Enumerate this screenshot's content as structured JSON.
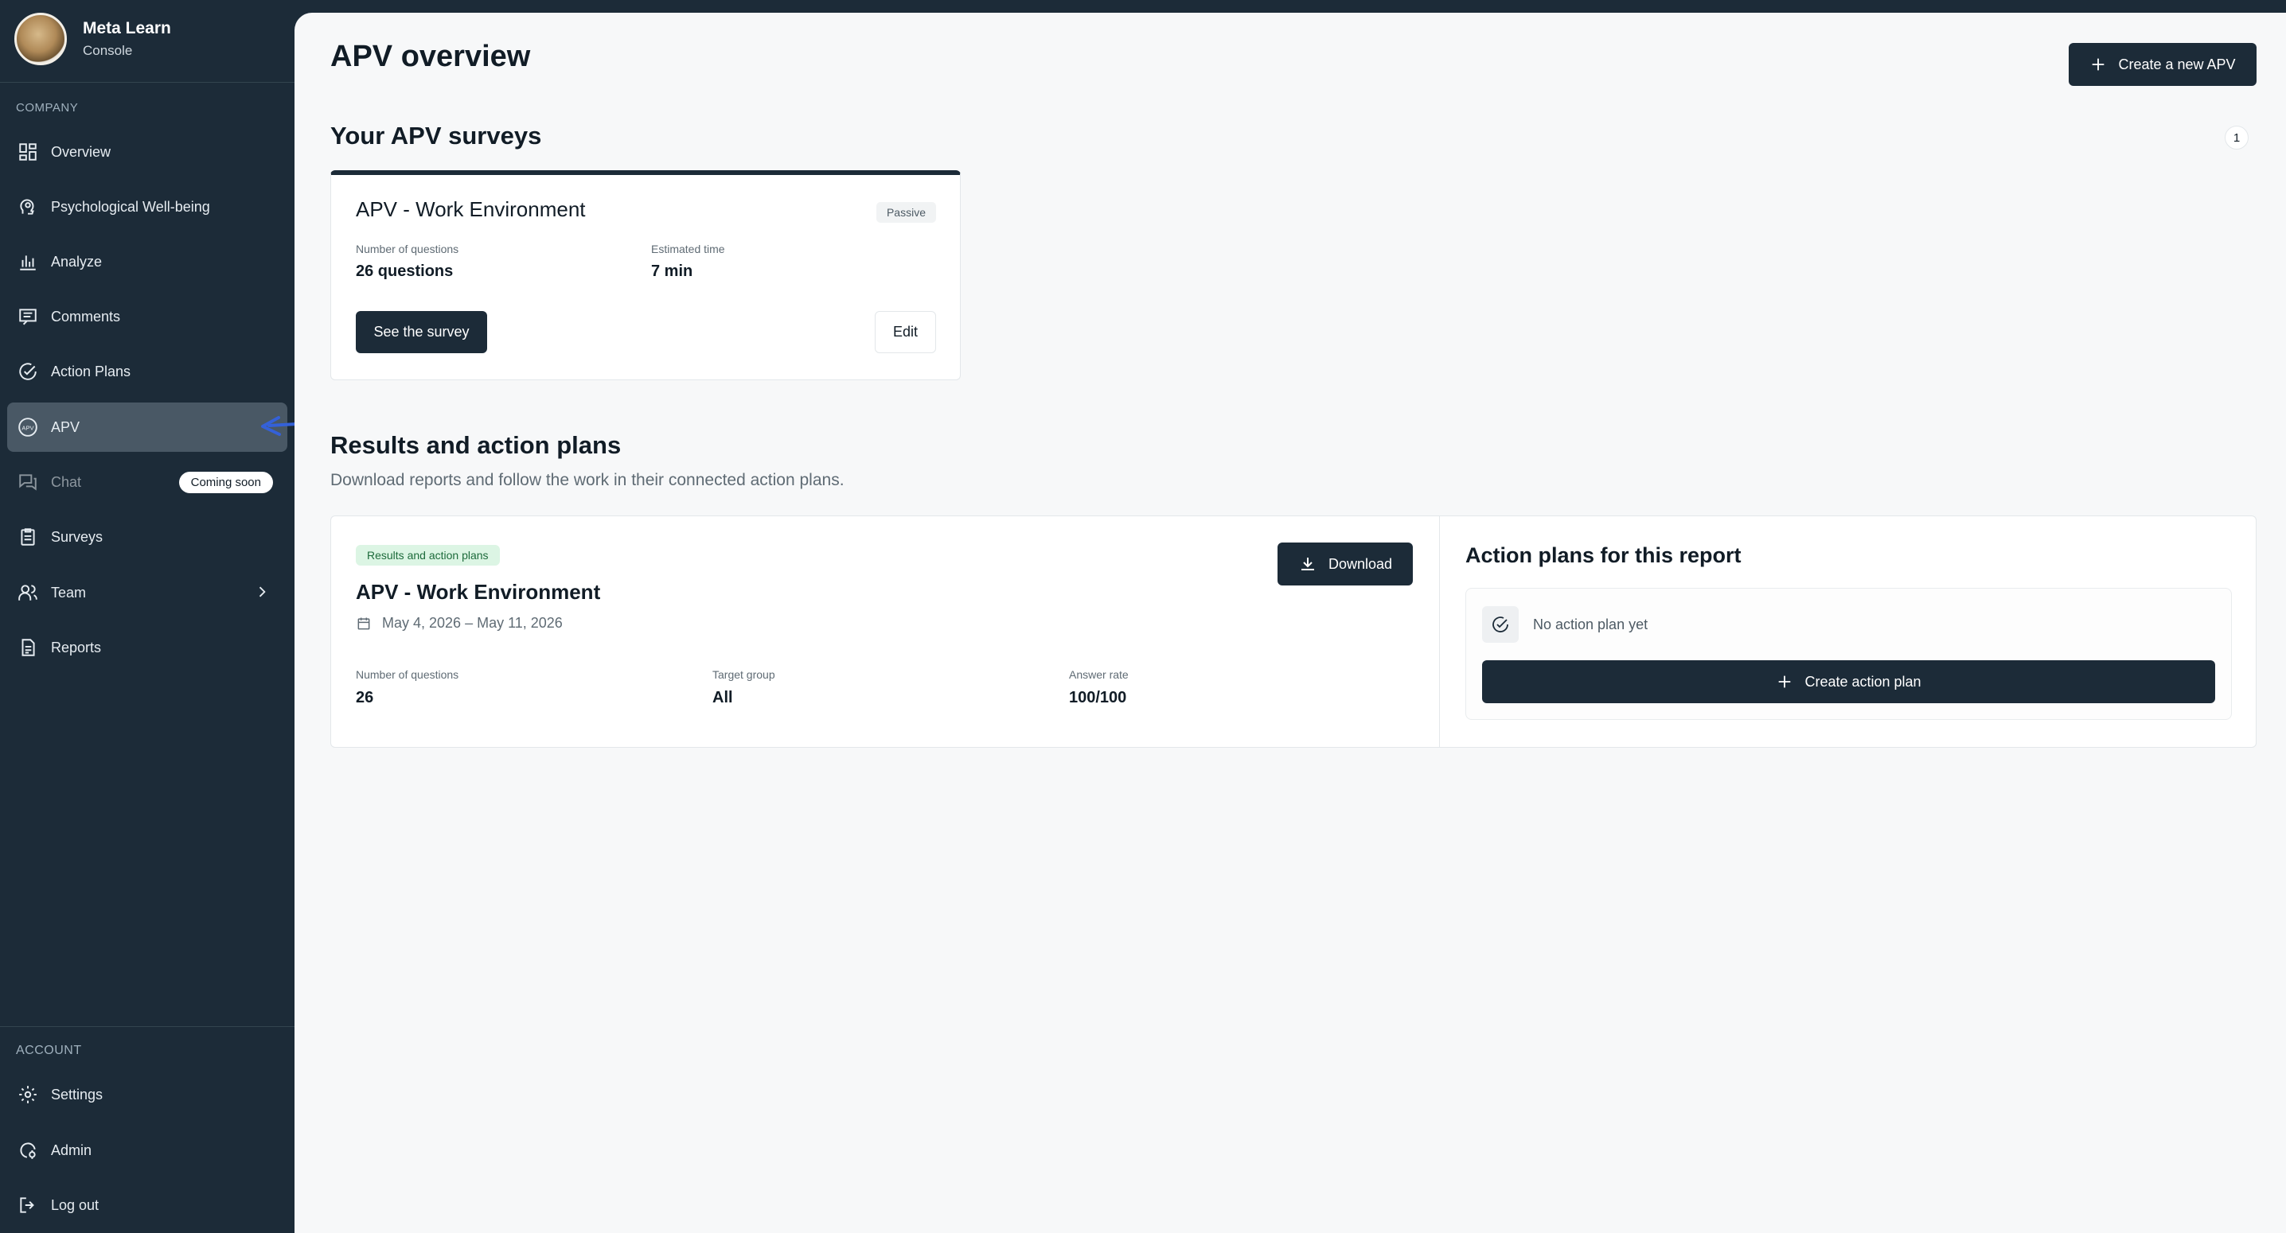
{
  "brand": {
    "name": "Meta Learn",
    "subtitle": "Console"
  },
  "sidebar": {
    "company_label": "COMPANY",
    "account_label": "ACCOUNT",
    "items": [
      {
        "label": "Overview",
        "icon": "grid-icon"
      },
      {
        "label": "Psychological Well-being",
        "icon": "head-icon"
      },
      {
        "label": "Analyze",
        "icon": "bar-chart-icon"
      },
      {
        "label": "Comments",
        "icon": "comment-icon"
      },
      {
        "label": "Action Plans",
        "icon": "check-circle-icon"
      },
      {
        "label": "APV",
        "icon": "apv-icon",
        "active": true
      },
      {
        "label": "Chat",
        "icon": "chat-icon",
        "badge": "Coming soon",
        "disabled": true
      },
      {
        "label": "Surveys",
        "icon": "clipboard-icon"
      },
      {
        "label": "Team",
        "icon": "users-icon",
        "has_submenu": true
      },
      {
        "label": "Reports",
        "icon": "document-icon"
      }
    ],
    "account_items": [
      {
        "label": "Settings",
        "icon": "gear-icon"
      },
      {
        "label": "Admin",
        "icon": "admin-icon"
      },
      {
        "label": "Log out",
        "icon": "logout-icon"
      }
    ]
  },
  "header": {
    "title": "APV overview",
    "create_button": "Create a new APV"
  },
  "surveys_section": {
    "title": "Your APV surveys",
    "count": "1",
    "card": {
      "title": "APV - Work Environment",
      "tag": "Passive",
      "questions_label": "Number of questions",
      "questions_value": "26 questions",
      "time_label": "Estimated time",
      "time_value": "7 min",
      "see_button": "See the survey",
      "edit_button": "Edit"
    }
  },
  "results_section": {
    "title": "Results and action plans",
    "subtitle": "Download reports and follow the work in their connected action plans.",
    "report": {
      "tag": "Results and action plans",
      "title": "APV - Work Environment",
      "date_range": "May 4, 2026 – May 11, 2026",
      "download_button": "Download",
      "questions_label": "Number of questions",
      "questions_value": "26",
      "target_label": "Target group",
      "target_value": "All",
      "answer_label": "Answer rate",
      "answer_value": "100/100"
    },
    "action_plans": {
      "title": "Action plans for this report",
      "empty_text": "No action plan yet",
      "create_button": "Create action plan"
    }
  },
  "colors": {
    "sidebar_bg": "#1c2b38",
    "active_item": "#495865",
    "accent_arrow": "#3461d8",
    "tag_green_bg": "#dcf5e4"
  }
}
